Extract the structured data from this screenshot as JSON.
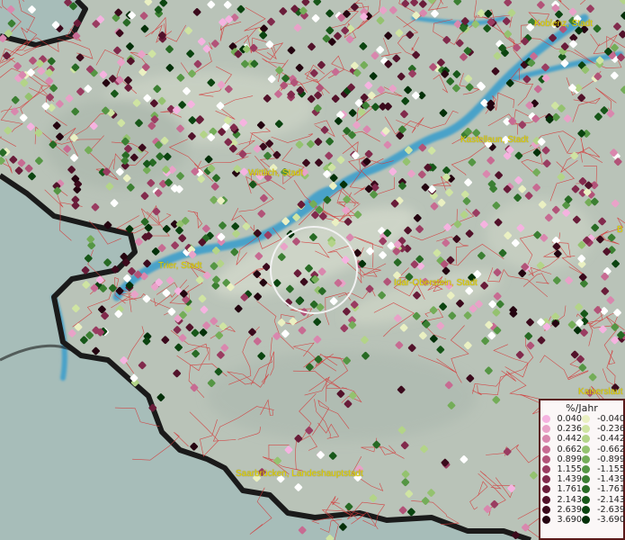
{
  "map": {
    "labels": [
      {
        "id": "koblenz",
        "text": "Koblenz, Stadt"
      },
      {
        "id": "kastellaun",
        "text": "Kastellaun, Stadt"
      },
      {
        "id": "wittlich",
        "text": "Wittlich, Stadt"
      },
      {
        "id": "trier",
        "text": "Trier, Stadt"
      },
      {
        "id": "idar-oberstein",
        "text": "Idar-Oberstein, Stadt"
      },
      {
        "id": "saarbruecken",
        "text": "Saarbrücken, Landeshauptstadt"
      },
      {
        "id": "kaiserslautern",
        "text": "Kaiserslaut"
      },
      {
        "id": "bingen",
        "text": "B"
      }
    ]
  },
  "legend": {
    "title": "%/Jahr",
    "positive": [
      "0.040",
      "0.236",
      "0.442",
      "0.662",
      "0.899",
      "1.155",
      "1.439",
      "1.761",
      "2.143",
      "2.639",
      "3.690"
    ],
    "negative": [
      "-0.040",
      "-0.236",
      "-0.442",
      "-0.662",
      "-0.899",
      "-1.155",
      "-1.439",
      "-1.761",
      "-2.143",
      "-2.639",
      "-3.690"
    ],
    "positive_colors": [
      "#f5b3e0",
      "#e9a2c8",
      "#d987ae",
      "#c76b92",
      "#b25378",
      "#9a3c61",
      "#812a4c",
      "#691c39",
      "#52122a",
      "#3b0a1c",
      "#240410"
    ],
    "negative_colors": [
      "#eaf0c2",
      "#cfe4a2",
      "#b3d488",
      "#94c26f",
      "#74ad58",
      "#559644",
      "#3b7f32",
      "#276a24",
      "#175719",
      "#0b4410",
      "#033009"
    ]
  }
}
